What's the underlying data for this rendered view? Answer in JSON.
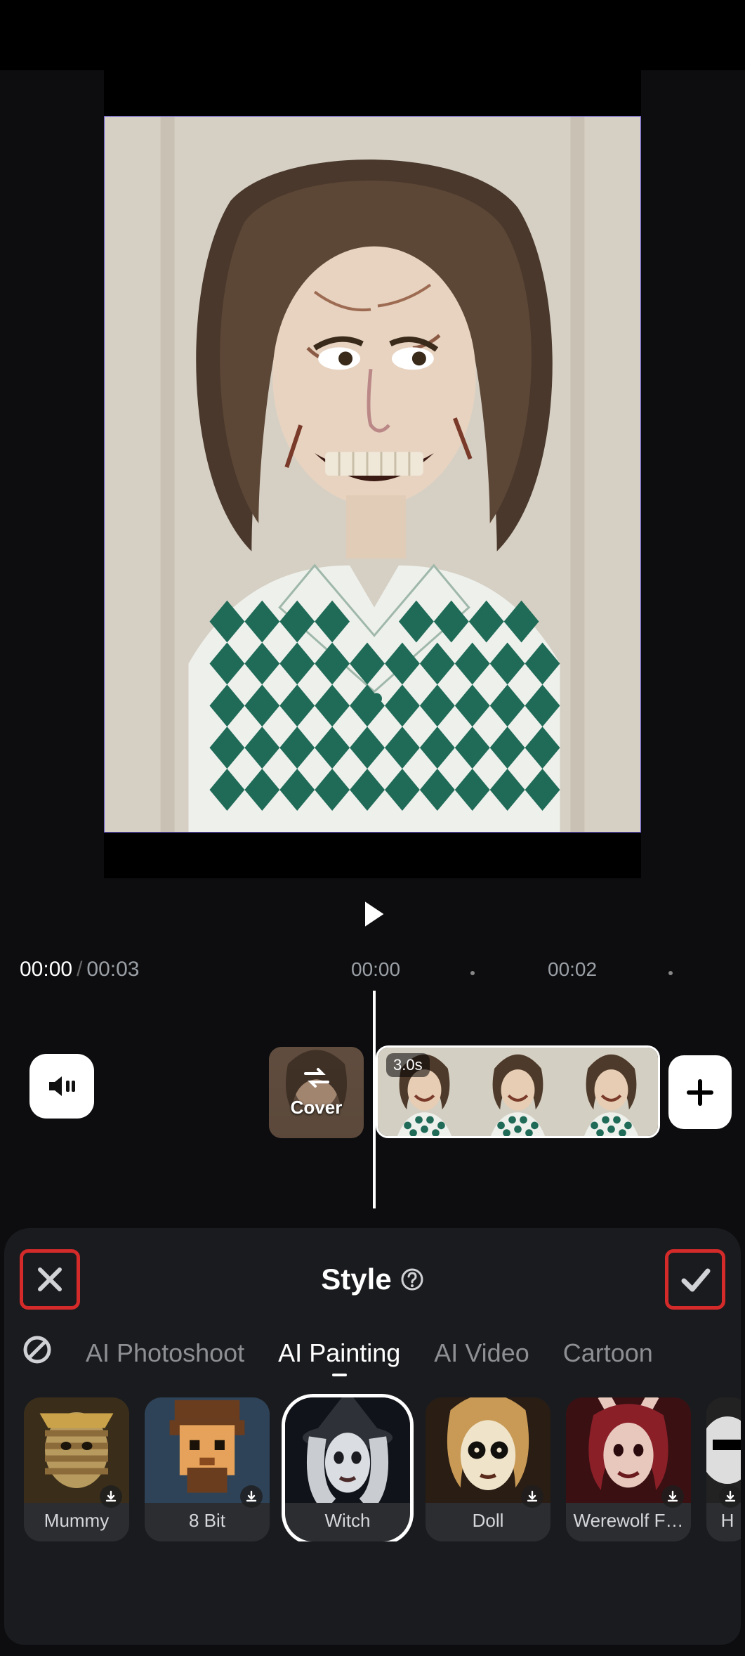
{
  "preview": {
    "alt": "Witch-style AI effect applied to portrait"
  },
  "playback": {
    "current": "00:00",
    "total": "00:03"
  },
  "ruler": {
    "marks": [
      "00:00",
      "00:02"
    ]
  },
  "clip": {
    "cover_label": "Cover",
    "duration": "3.0s"
  },
  "panel": {
    "title": "Style",
    "tabs": [
      "AI Photoshoot",
      "AI Painting",
      "AI Video",
      "Cartoon"
    ],
    "active_tab": "AI Painting",
    "styles": [
      {
        "name": "Mummy",
        "downloadable": true,
        "selected": false,
        "palette": [
          "#b79a5e",
          "#3a2e1a",
          "#8c6b3a"
        ]
      },
      {
        "name": "8 Bit",
        "downloadable": true,
        "selected": false,
        "palette": [
          "#e6a25a",
          "#6b3d1f",
          "#2e4358"
        ]
      },
      {
        "name": "Witch",
        "downloadable": false,
        "selected": true,
        "palette": [
          "#2e3238",
          "#c9cdd2",
          "#11131a"
        ]
      },
      {
        "name": "Doll",
        "downloadable": true,
        "selected": false,
        "palette": [
          "#c89a55",
          "#2a1d14",
          "#efe3c9"
        ]
      },
      {
        "name": "Werewolf F…",
        "downloadable": true,
        "selected": false,
        "palette": [
          "#8a1f28",
          "#e8c7bd",
          "#3a1012"
        ]
      },
      {
        "name": "H",
        "downloadable": true,
        "selected": false,
        "palette": [
          "#dddddd",
          "#222222",
          "#888888"
        ]
      }
    ]
  },
  "colors": {
    "highlight": "#d42a2a",
    "panel": "#1a1b1e"
  }
}
